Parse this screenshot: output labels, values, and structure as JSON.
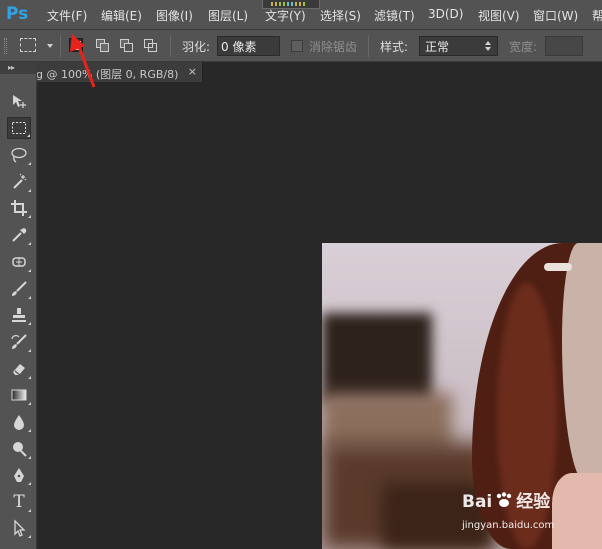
{
  "app": {
    "logo": "Ps",
    "accent_color": "#2fa3e6"
  },
  "menubar": {
    "items": [
      "文件(F)",
      "编辑(E)",
      "图像(I)",
      "图层(L)",
      "文字(Y)",
      "选择(S)",
      "滤镜(T)",
      "3D(D)",
      "视图(V)",
      "窗口(W)",
      "帮"
    ]
  },
  "options": {
    "feather_label": "羽化:",
    "feather_value": "0 像素",
    "antialias_label": "消除锯齿",
    "style_label": "样式:",
    "style_value": "正常",
    "width_label": "宽度:"
  },
  "document": {
    "tab_label": "ng @ 100% (图层 0, RGB/8)",
    "close": "×"
  },
  "toolbox": {
    "collapse": "▸▸",
    "tools": [
      "move-icon",
      "rect-marquee-icon",
      "lasso-icon",
      "magic-wand-icon",
      "crop-icon",
      "eyedropper-icon",
      "healing-brush-icon",
      "brush-icon",
      "clone-stamp-icon",
      "history-brush-icon",
      "eraser-icon",
      "gradient-icon",
      "blur-icon",
      "dodge-icon",
      "pen-icon",
      "type-icon",
      "path-select-icon"
    ],
    "type_glyph": "T"
  },
  "watermark": {
    "brand_left": "Bai",
    "brand_right": "经验",
    "url": "jingyan.baidu.com"
  },
  "annotation_color": "#e8231c"
}
